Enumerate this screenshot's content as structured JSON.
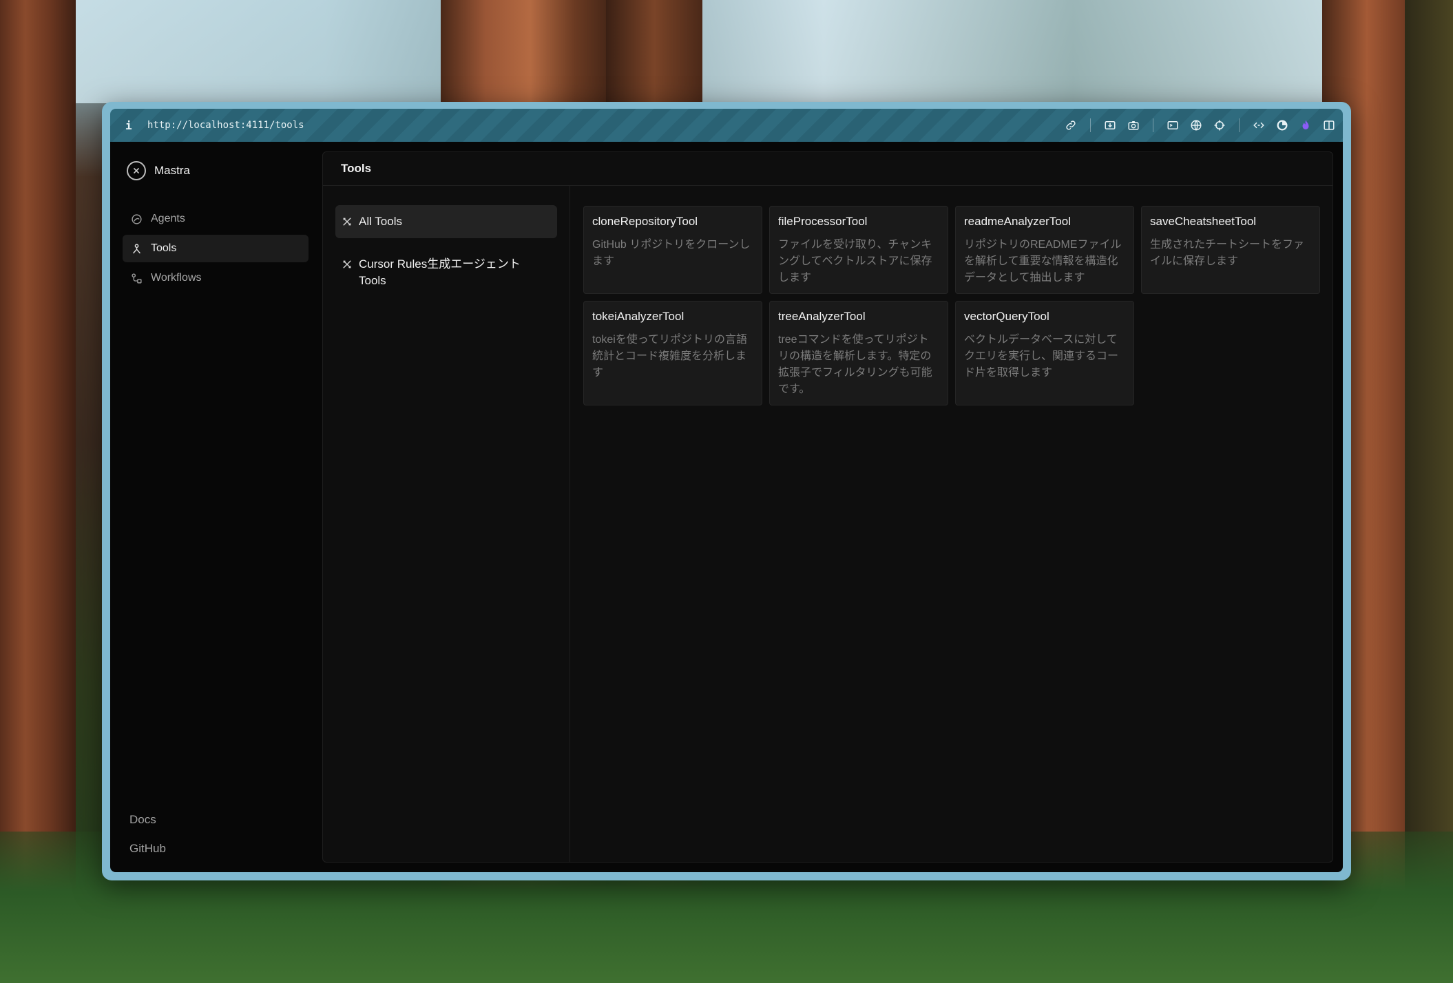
{
  "browser": {
    "url": "http://localhost:4111/tools",
    "info_glyph": "i"
  },
  "sidebar": {
    "brand": "Mastra",
    "nav": [
      {
        "label": "Agents",
        "icon": "agent-icon"
      },
      {
        "label": "Tools",
        "icon": "tools-icon"
      },
      {
        "label": "Workflows",
        "icon": "workflow-icon"
      }
    ],
    "footer": [
      "Docs",
      "GitHub"
    ]
  },
  "main": {
    "title": "Tools",
    "categories": [
      {
        "label": "All Tools",
        "icon": "tools-icon"
      },
      {
        "label": "Cursor Rules生成エージェント Tools",
        "icon": "tools-icon"
      }
    ],
    "tools": [
      {
        "name": "cloneRepositoryTool",
        "description": "GitHub リポジトリをクローンします"
      },
      {
        "name": "fileProcessorTool",
        "description": "ファイルを受け取り、チャンキングしてベクトルストアに保存します"
      },
      {
        "name": "readmeAnalyzerTool",
        "description": "リポジトリのREADMEファイルを解析して重要な情報を構造化データとして抽出します"
      },
      {
        "name": "saveCheatsheetTool",
        "description": "生成されたチートシートをファイルに保存します"
      },
      {
        "name": "tokeiAnalyzerTool",
        "description": "tokeiを使ってリポジトリの言語統計とコード複雑度を分析します"
      },
      {
        "name": "treeAnalyzerTool",
        "description": "treeコマンドを使ってリポジトリの構造を解析します。特定の拡張子でフィルタリングも可能です。"
      },
      {
        "name": "vectorQueryTool",
        "description": "ベクトルデータベースに対してクエリを実行し、関連するコード片を取得します"
      }
    ]
  },
  "colors": {
    "frame": "#7fb8cf",
    "urlbar": "#2f6b7e",
    "app_bg": "#070707",
    "card_bg": "#1a1a1a",
    "accent_purple": "#8b5cf6"
  }
}
